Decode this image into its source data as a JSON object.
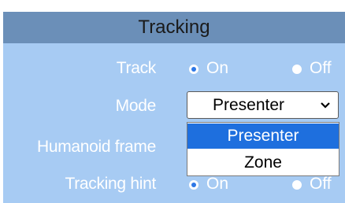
{
  "section": {
    "title": "Tracking"
  },
  "track": {
    "label": "Track",
    "on_label": "On",
    "off_label": "Off",
    "selected": "On"
  },
  "mode": {
    "label": "Mode",
    "selected": "Presenter",
    "options": [
      "Presenter",
      "Zone"
    ]
  },
  "humanoid_frame": {
    "label": "Humanoid frame"
  },
  "tracking_hint": {
    "label": "Tracking hint",
    "on_label": "On",
    "off_label": "Off",
    "selected": "On"
  },
  "colors": {
    "panel": "#a7cbf3",
    "header": "#6b8fb8",
    "selection": "#1e6fde"
  }
}
